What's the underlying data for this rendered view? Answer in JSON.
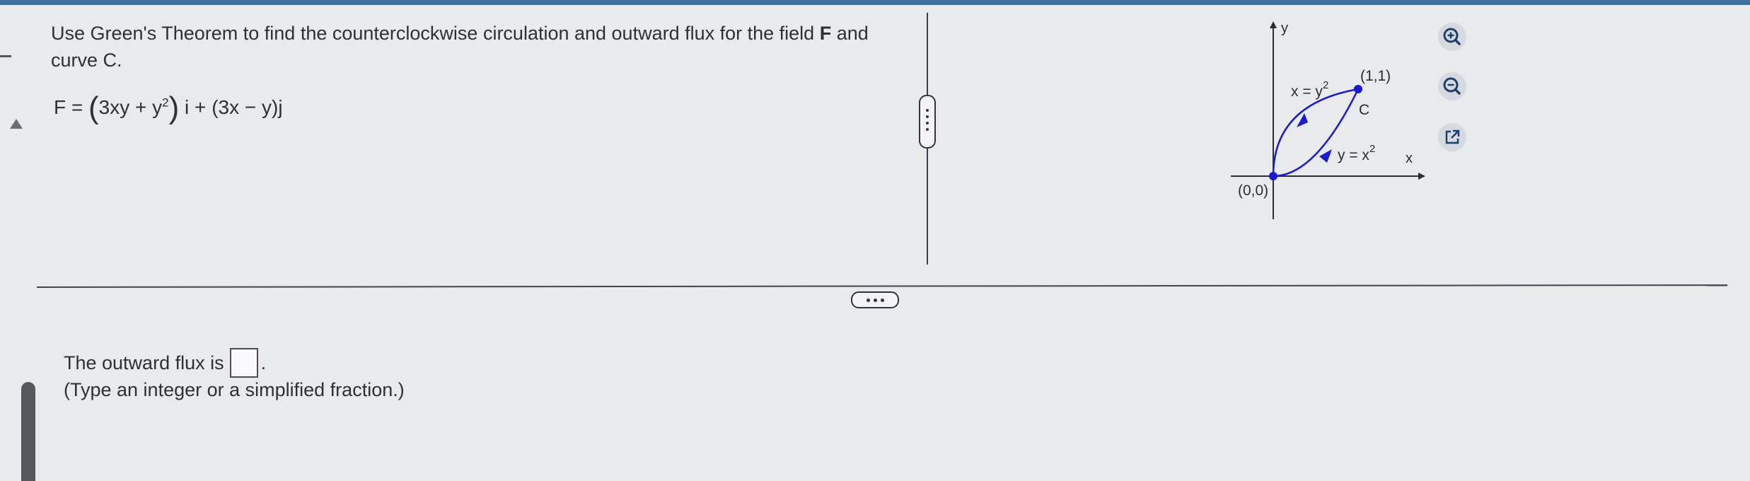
{
  "question": {
    "text_before": "Use Green's Theorem to find the counterclockwise circulation and outward flux for the field ",
    "field_symbol": "F",
    "text_after": " and curve C."
  },
  "formula": {
    "lhs": "F =",
    "open_paren": "(",
    "term_a": "3xy + y",
    "exp": "2",
    "close_paren": ")",
    "i_part": " i + (3x − y)j"
  },
  "graph": {
    "y_axis_label": "y",
    "x_axis_label": "x",
    "curve_upper_label": "x = y",
    "curve_upper_exp": "2",
    "curve_lower_label": "y = x",
    "curve_lower_exp": "2",
    "point_top_label": "(1,1)",
    "curve_label": "C",
    "origin_label": "(0,0)"
  },
  "tools": {
    "zoom_in": "zoom-in-icon",
    "zoom_out": "zoom-out-icon",
    "popout": "external-link-icon"
  },
  "answer": {
    "prompt": "The outward flux is",
    "suffix": ".",
    "hint": "(Type an integer or a simplified fraction.)"
  },
  "colors": {
    "accent_top_bar": "#3f6f9e",
    "curve_blue": "#1a1ad6",
    "text": "#2d3035",
    "background": "#e9eaec"
  }
}
